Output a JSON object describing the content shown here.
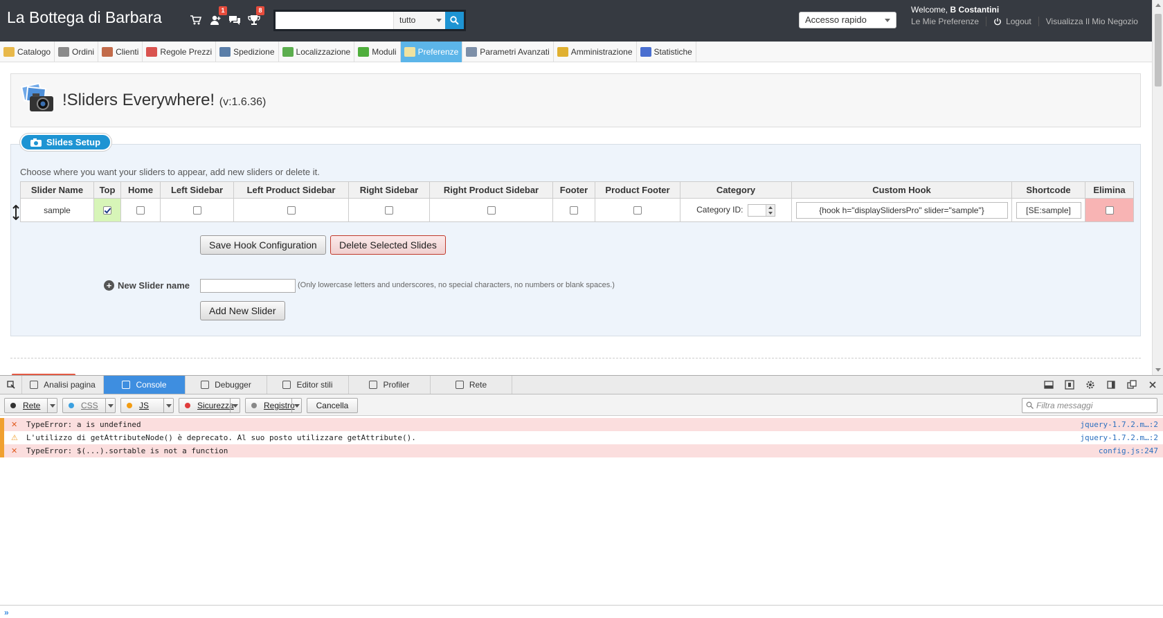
{
  "header": {
    "shop_name": "La Bottega di Barbara",
    "badges": {
      "customers": "1",
      "orders": "8"
    },
    "search_placeholder": "",
    "search_scope": "tutto",
    "quick_access": "Accesso rapido",
    "welcome_prefix": "Welcome,",
    "user_name": "B Costantini",
    "links": {
      "preferences": "Le Mie Preferenze",
      "logout": "Logout",
      "view_shop": "Visualizza Il Mio Negozio"
    }
  },
  "nav": [
    {
      "label": "Catalogo",
      "icon": "folder-icon",
      "color": "#e8b84a"
    },
    {
      "label": "Ordini",
      "icon": "cart-icon",
      "color": "#8a8a8a"
    },
    {
      "label": "Clienti",
      "icon": "user-icon",
      "color": "#c26b4a"
    },
    {
      "label": "Regole Prezzi",
      "icon": "price-rules-icon",
      "color": "#d9534f"
    },
    {
      "label": "Spedizione",
      "icon": "truck-icon",
      "color": "#5a7ea8"
    },
    {
      "label": "Localizzazione",
      "icon": "globe-icon",
      "color": "#5cae4e"
    },
    {
      "label": "Moduli",
      "icon": "puzzle-icon",
      "color": "#4fae3c"
    },
    {
      "label": "Preferenze",
      "icon": "preferences-icon",
      "color": "#f0e2a0",
      "active": true
    },
    {
      "label": "Parametri Avanzati",
      "icon": "wrench-icon",
      "color": "#7d8fa8"
    },
    {
      "label": "Amministrazione",
      "icon": "key-icon",
      "color": "#e0b030"
    },
    {
      "label": "Statistiche",
      "icon": "chart-icon",
      "color": "#4a6fd0"
    }
  ],
  "module": {
    "title": "!Sliders Everywhere!",
    "version": "(v:1.6.36)"
  },
  "setup": {
    "badge": "Slides Setup",
    "intro": "Choose where you want your sliders to appear, add new sliders or delete it.",
    "columns": [
      "Slider Name",
      "Top",
      "Home",
      "Left Sidebar",
      "Left Product Sidebar",
      "Right Sidebar",
      "Right Product Sidebar",
      "Footer",
      "Product Footer",
      "Category",
      "Custom Hook",
      "Shortcode",
      "Elimina"
    ],
    "row": {
      "name": "sample",
      "top": true,
      "home": false,
      "left_sidebar": false,
      "left_product_sidebar": false,
      "right_sidebar": false,
      "right_product_sidebar": false,
      "footer": false,
      "product_footer": false,
      "category_label": "Category ID:",
      "category_value": "",
      "custom_hook": "{hook h=\"displaySlidersPro\" slider=\"sample\"}",
      "shortcode": "[SE:sample]",
      "delete": false
    },
    "save_button": "Save Hook Configuration",
    "delete_button": "Delete Selected Slides",
    "new_slider_label": "New Slider name",
    "new_slider_value": "",
    "new_slider_hint": "(Only lowercase letters and underscores, no special characters, no numbers or blank spaces.)",
    "add_button": "Add New Slider"
  },
  "devtools": {
    "tabs": [
      {
        "label": "Analisi pagina",
        "icon": "inspector-icon"
      },
      {
        "label": "Console",
        "icon": "console-icon",
        "active": true
      },
      {
        "label": "Debugger",
        "icon": "debugger-icon"
      },
      {
        "label": "Editor stili",
        "icon": "style-editor-icon"
      },
      {
        "label": "Profiler",
        "icon": "profiler-icon"
      },
      {
        "label": "Rete",
        "icon": "network-icon"
      }
    ],
    "filters": [
      {
        "label": "Rete",
        "color": "#333333"
      },
      {
        "label": "CSS",
        "color": "#3ba0e0",
        "muted": true
      },
      {
        "label": "JS",
        "color": "#f39c12"
      },
      {
        "label": "Sicurezza",
        "color": "#e03c3c"
      },
      {
        "label": "Registro",
        "color": "#888888"
      }
    ],
    "clear_button": "Cancella",
    "filter_placeholder": "Filtra messaggi",
    "messages": [
      {
        "type": "error",
        "icon": "error-icon",
        "text": "TypeError: a is undefined",
        "source": "jquery-1.7.2.m…:2"
      },
      {
        "type": "warn",
        "icon": "warning-icon",
        "text": "L'utilizzo di getAttributeNode() è deprecato. Al suo posto utilizzare getAttribute().",
        "source": "jquery-1.7.2.m…:2"
      },
      {
        "type": "error",
        "icon": "error-icon",
        "text": "TypeError: $(...).sortable is not a function",
        "source": "config.js:247"
      }
    ],
    "prompt": "»"
  }
}
